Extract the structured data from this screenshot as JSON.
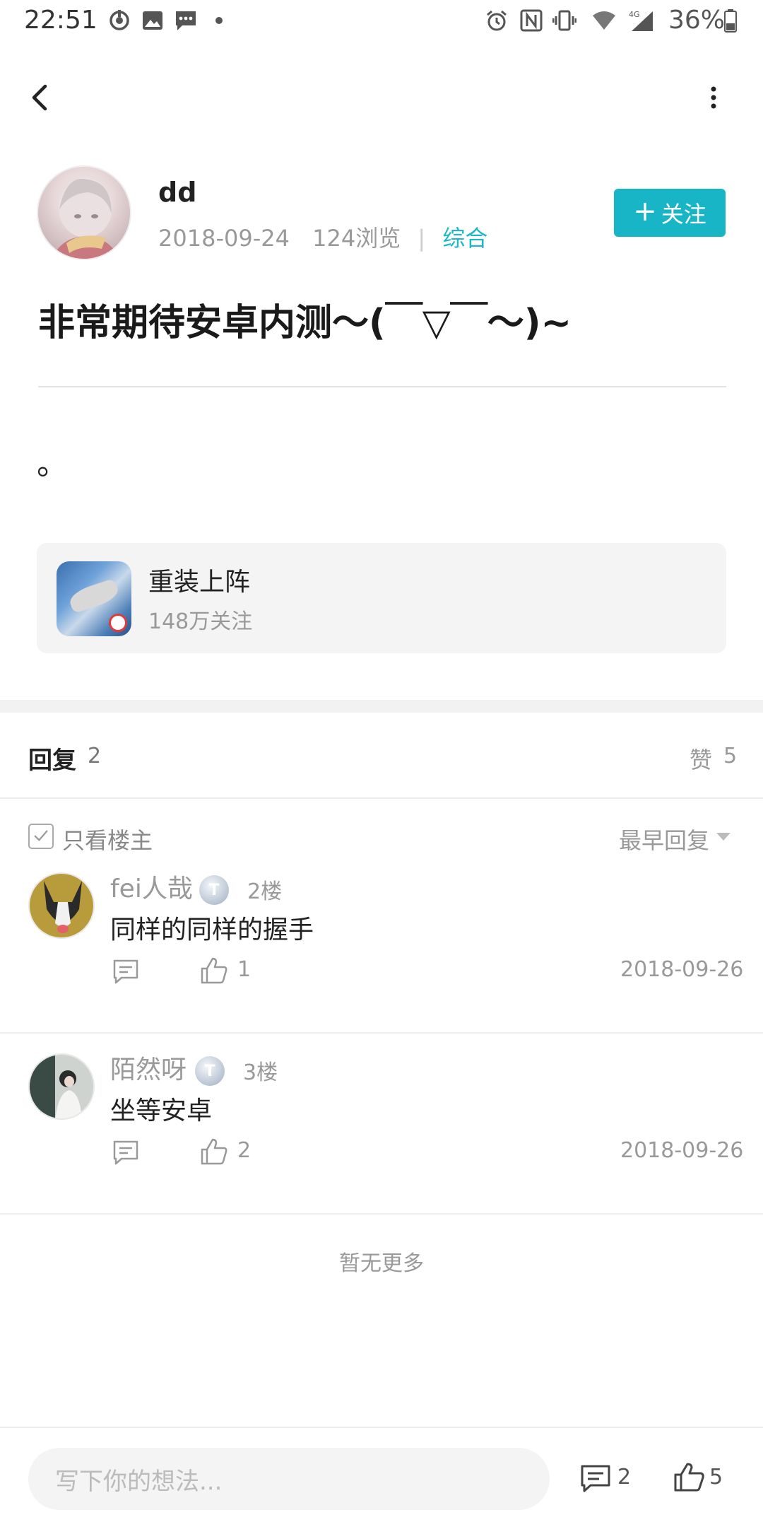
{
  "status_bar": {
    "time": "22:51",
    "battery": "36%",
    "left_icons": [
      "sync-icon",
      "image-icon",
      "message-icon",
      "dot-icon"
    ],
    "right_icons": [
      "alarm-icon",
      "nfc-icon",
      "vibrate-icon",
      "wifi-icon",
      "signal-4g-icon",
      "battery-icon"
    ]
  },
  "header": {
    "back_icon": "chevron-left-icon",
    "more_icon": "more-vertical-icon"
  },
  "post": {
    "author": "dd",
    "date": "2018-09-24",
    "views": "124浏览",
    "category": "综合",
    "follow_label": "关注",
    "title": "非常期待安卓内测～(￣▽￣～)~",
    "body": "。"
  },
  "game": {
    "name": "重装上阵",
    "followers": "148万关注"
  },
  "replies_header": {
    "label": "回复",
    "count": "2",
    "likes_label": "赞",
    "likes_count": "5",
    "only_op_label": "只看楼主",
    "sort_label": "最早回复"
  },
  "replies": [
    {
      "name": "fei人哉",
      "badge": "T",
      "floor": "2楼",
      "content": "同样的同样的握手",
      "likes": "1",
      "date": "2018-09-26"
    },
    {
      "name": "陌然呀",
      "badge": "T",
      "floor": "3楼",
      "content": "坐等安卓",
      "likes": "2",
      "date": "2018-09-26"
    }
  ],
  "no_more": "暂无更多",
  "bottom_bar": {
    "placeholder": "写下你的想法...",
    "comment_count": "2",
    "like_count": "5"
  },
  "colors": {
    "accent": "#18b5c6",
    "category": "#1fb6c8"
  }
}
